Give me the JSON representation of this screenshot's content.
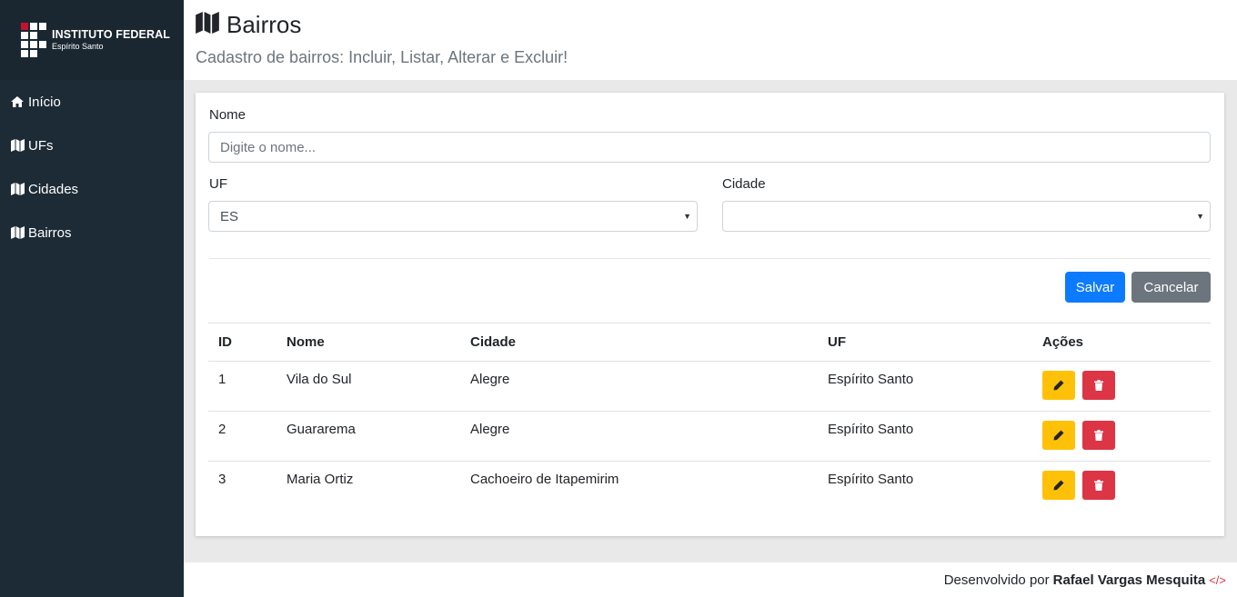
{
  "brand": {
    "line1": "INSTITUTO FEDERAL",
    "line2": "Espírito Santo"
  },
  "sidebar": {
    "items": [
      {
        "label": "Início",
        "icon": "home-icon"
      },
      {
        "label": "UFs",
        "icon": "map-icon"
      },
      {
        "label": "Cidades",
        "icon": "map-icon"
      },
      {
        "label": "Bairros",
        "icon": "map-icon"
      }
    ]
  },
  "header": {
    "title": "Bairros",
    "subtitle": "Cadastro de bairros: Incluir, Listar, Alterar e Excluir!"
  },
  "form": {
    "nome_label": "Nome",
    "nome_placeholder": "Digite o nome...",
    "nome_value": "",
    "uf_label": "UF",
    "uf_selected": "ES",
    "cidade_label": "Cidade",
    "cidade_selected": "",
    "save_label": "Salvar",
    "cancel_label": "Cancelar"
  },
  "table": {
    "headers": [
      "ID",
      "Nome",
      "Cidade",
      "UF",
      "Ações"
    ],
    "rows": [
      {
        "id": "1",
        "nome": "Vila do Sul",
        "cidade": "Alegre",
        "uf": "Espírito Santo"
      },
      {
        "id": "2",
        "nome": "Guararema",
        "cidade": "Alegre",
        "uf": "Espírito Santo"
      },
      {
        "id": "3",
        "nome": "Maria Ortiz",
        "cidade": "Cachoeiro de Itapemirim",
        "uf": "Espírito Santo"
      }
    ]
  },
  "footer": {
    "prefix": "Desenvolvido por",
    "author": "Rafael Vargas Mesquita",
    "code_icon": "</>"
  },
  "colors": {
    "sidebar_bg": "#1d2b36",
    "primary": "#0d7bff",
    "secondary": "#6c757d",
    "warning": "#ffc107",
    "danger": "#dc3545"
  }
}
